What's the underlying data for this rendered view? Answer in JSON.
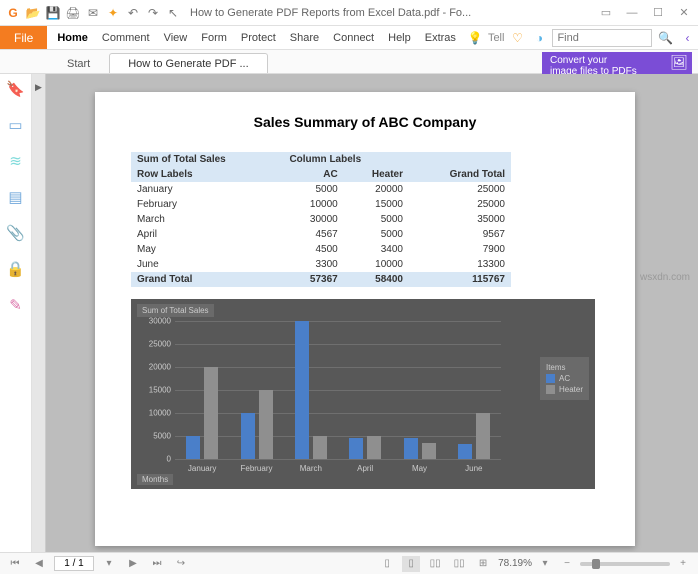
{
  "titlebar": {
    "title": "How to Generate PDF Reports from Excel Data.pdf - Fo..."
  },
  "ribbon": {
    "file": "File",
    "menus": [
      "Home",
      "Comment",
      "View",
      "Form",
      "Protect",
      "Share",
      "Connect",
      "Help",
      "Extras"
    ],
    "tell": "Tell",
    "find_placeholder": "Find"
  },
  "tabs": {
    "start": "Start",
    "doc": "How to Generate PDF ..."
  },
  "promo": {
    "l1": "Convert your",
    "l2": "image files to PDFs"
  },
  "report": {
    "title": "Sales Summary of ABC Company",
    "h_sum": "Sum of Total Sales",
    "h_col": "Column Labels",
    "h_row": "Row Labels",
    "c1": "AC",
    "c2": "Heater",
    "c3": "Grand Total",
    "rows": [
      {
        "m": "January",
        "ac": "5000",
        "ht": "20000",
        "gt": "25000"
      },
      {
        "m": "February",
        "ac": "10000",
        "ht": "15000",
        "gt": "25000"
      },
      {
        "m": "March",
        "ac": "30000",
        "ht": "5000",
        "gt": "35000"
      },
      {
        "m": "April",
        "ac": "4567",
        "ht": "5000",
        "gt": "9567"
      },
      {
        "m": "May",
        "ac": "4500",
        "ht": "3400",
        "gt": "7900"
      },
      {
        "m": "June",
        "ac": "3300",
        "ht": "10000",
        "gt": "13300"
      }
    ],
    "total": {
      "m": "Grand Total",
      "ac": "57367",
      "ht": "58400",
      "gt": "115767"
    }
  },
  "chart_data": {
    "type": "bar",
    "title": "Sum of Total Sales",
    "xlabel": "Months",
    "legend_title": "Items",
    "categories": [
      "January",
      "February",
      "March",
      "April",
      "May",
      "June"
    ],
    "series": [
      {
        "name": "AC",
        "values": [
          5000,
          10000,
          30000,
          4567,
          4500,
          3300
        ],
        "color": "#4a7fc9"
      },
      {
        "name": "Heater",
        "values": [
          20000,
          15000,
          5000,
          5000,
          3400,
          10000
        ],
        "color": "#8f8f8f"
      }
    ],
    "yticks": [
      0,
      5000,
      10000,
      15000,
      20000,
      25000,
      30000
    ],
    "ylim": [
      0,
      30000
    ]
  },
  "status": {
    "page": "1 / 1",
    "zoom": "78.19%"
  },
  "watermark": "wsxdn.com"
}
